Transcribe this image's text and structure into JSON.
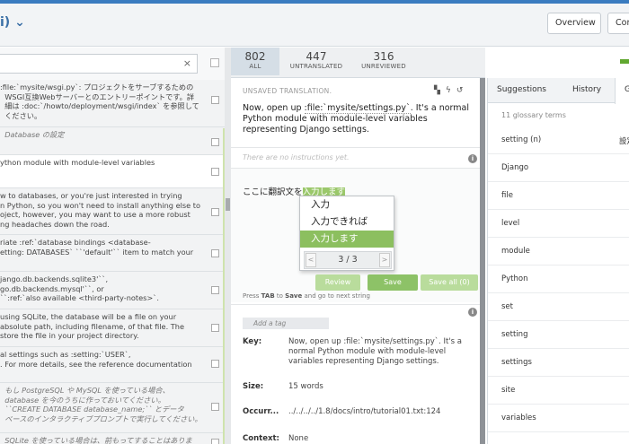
{
  "header": {
    "title_partial": "i)",
    "title_chevron": "⌄",
    "overview_label": "Overview",
    "cont_label": "Con"
  },
  "left": {
    "search_clear": "×",
    "rows": [
      {
        "text": ":file:`mysite/wsgi.py`: プロジェクトをサーブするための\n  WSGI互換Webサーバーとのエントリーポイントです。詳\n  細は :doc:`/howto/deployment/wsgi/index` を参照して\n  ください。",
        "ital": false
      },
      {
        "text": "  Database の設定",
        "ital": true
      },
      {
        "text": "ython module with module-level variables",
        "ital": false
      },
      {
        "text": "w to databases, or you're just interested in trying\nn Python, so you won't need to install anything else to\noject, however, you may want to use a more robust\nng headaches down the road.",
        "ital": false
      },
      {
        "text": "riate :ref:`database bindings <database-\netting: DATABASES` ``'default'`` item to match your",
        "ital": false
      },
      {
        "text": "jango.db.backends.sqlite3'``,\ngo.db.backends.mysql'``, or\n``:ref:`also available <third-party-notes>`.",
        "ital": false
      },
      {
        "text": "using SQLite, the database will be a file on your\nabsolute path, including filename, of that file. The\nstore the file in your project directory.",
        "ital": false
      },
      {
        "text": "al settings such as :setting:`USER`,\n. For more details, see the reference documentation",
        "ital": false
      },
      {
        "text": "  もし PostgreSQL や MySQL を使っている場合、\n  database を今のうちに作っておいてください。\n  ``CREATE DATABASE database_name;`` とデータ\n  ベースのインタラクティブプロンプトで実行してください。",
        "ital": true
      },
      {
        "text": "  SQLite を使っている場合は、前もってすることはありま",
        "ital": true
      }
    ]
  },
  "stats": [
    {
      "num": "802",
      "label": "ALL"
    },
    {
      "num": "447",
      "label": "UNTRANSLATED"
    },
    {
      "num": "316",
      "label": "UNREVIEWED"
    }
  ],
  "editor": {
    "unsaved_label": "UNSAVED TRANSLATION.",
    "source_pre": "Now, open up ",
    "source_file": ":file:`mysite/settings.py`",
    "source_post": ". It's a normal Python module with module-level variables representing Django settings.",
    "no_instructions": "There are no instructions yet.",
    "translation_prefix": "ここに翻訳文を",
    "translation_highlight": "入力します",
    "suggestions": [
      "入力",
      "入力できれば",
      "入力します"
    ],
    "selected_index": 2,
    "pager_text": "3 / 3",
    "pager_prev": "<",
    "pager_next": ">",
    "review_label": "Review",
    "save_label": "Save",
    "save_all_label": "Save all (0)",
    "hint_press": "Press",
    "hint_tab": "TAB",
    "hint_to": "to",
    "hint_save": "Save",
    "hint_rest": "and go to next string",
    "add_tag_placeholder": "Add a tag"
  },
  "meta": [
    {
      "key": "Key:",
      "value": "Now, open up :file:`mysite/settings.py`. It's a normal Python module with module-level variables representing Django settings."
    },
    {
      "key": "Size:",
      "value": "15 words"
    },
    {
      "key": "Occurr...",
      "value": "../../../../1.8/docs/intro/tutorial01.txt:124"
    },
    {
      "key": "Context:",
      "value": "None"
    }
  ],
  "right": {
    "tabs": [
      "Suggestions",
      "History",
      "G"
    ],
    "glossary_count": "11 glossary terms",
    "glossary": [
      {
        "term": "setting (n)",
        "def": "設定"
      },
      {
        "term": "Django",
        "def": ""
      },
      {
        "term": "file",
        "def": ""
      },
      {
        "term": "level",
        "def": ""
      },
      {
        "term": "module",
        "def": ""
      },
      {
        "term": "Python",
        "def": ""
      },
      {
        "term": "set",
        "def": ""
      },
      {
        "term": "setting",
        "def": ""
      },
      {
        "term": "settings",
        "def": ""
      },
      {
        "term": "site",
        "def": ""
      },
      {
        "term": "variables",
        "def": ""
      }
    ]
  },
  "colors": {
    "accent_blue": "#3a7cc0",
    "highlight_green": "#9bc86b",
    "selected_green": "#8cbf5f",
    "button_green": "#8dc267"
  }
}
